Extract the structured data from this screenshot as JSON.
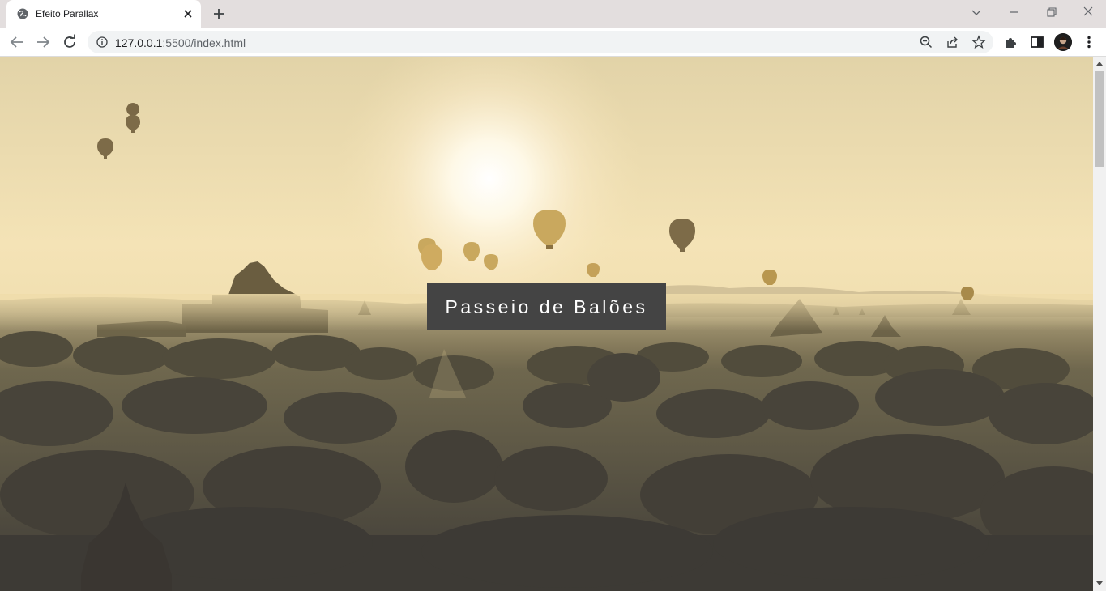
{
  "browser": {
    "tab": {
      "title": "Efeito Parallax",
      "favicon": "globe-icon"
    },
    "address": {
      "host": "127.0.0.1",
      "port_path": ":5500/index.html"
    },
    "icons": {
      "back": "arrow-left-icon",
      "forward": "arrow-right-icon",
      "reload": "reload-icon",
      "zoom": "zoom-out-icon",
      "share": "share-icon",
      "bookmark": "star-icon",
      "extensions": "puzzle-icon",
      "side_panel": "side-panel-icon",
      "menu": "kebab-menu-icon"
    }
  },
  "page": {
    "hero_title": "Passeio de Balões",
    "colors": {
      "title_bg": "#444444",
      "title_text": "#ffffff",
      "sky_top": "#e8d9b0",
      "sky_glow": "#fff7d8",
      "ground_dark": "#3f3c36"
    }
  }
}
